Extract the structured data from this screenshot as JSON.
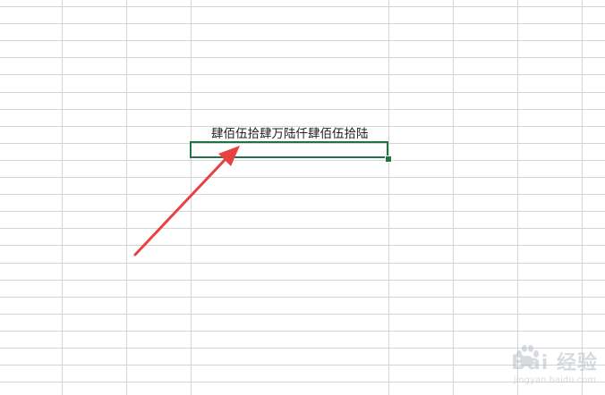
{
  "spreadsheet": {
    "cell_value": "肆佰伍拾肆万陆仟肆佰伍拾陆"
  },
  "annotation": {
    "arrow_color": "#e84142"
  },
  "watermark": {
    "brand": "Bai 经验",
    "url": "jingyan.baidu.com"
  },
  "colors": {
    "selection_border": "#217346",
    "gridline": "#d4d4d4"
  }
}
